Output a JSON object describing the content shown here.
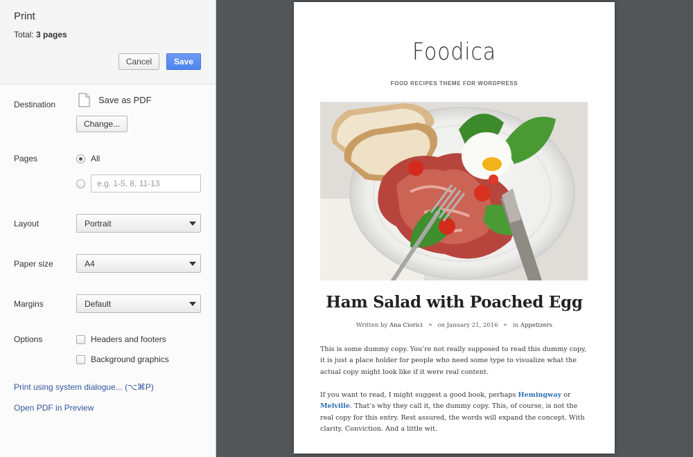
{
  "header": {
    "title": "Print",
    "total_label": "Total:",
    "total_value": "3 pages",
    "cancel_label": "Cancel",
    "save_label": "Save"
  },
  "destination": {
    "label": "Destination",
    "value": "Save as PDF",
    "change_label": "Change..."
  },
  "pages": {
    "label": "Pages",
    "all_label": "All",
    "all_selected": true,
    "custom_placeholder": "e.g. 1-5, 8, 11-13"
  },
  "layout": {
    "label": "Layout",
    "value": "Portrait"
  },
  "paper_size": {
    "label": "Paper size",
    "value": "A4"
  },
  "margins": {
    "label": "Margins",
    "value": "Default"
  },
  "options": {
    "label": "Options",
    "headers_footers": {
      "label": "Headers and footers",
      "checked": false
    },
    "background_graphics": {
      "label": "Background graphics",
      "checked": false
    }
  },
  "links": {
    "system_dialog": "Print using system dialogue... (⌥⌘P)",
    "open_pdf": "Open PDF in Preview"
  },
  "preview": {
    "site_title": "Foodica",
    "tagline": "FOOD RECIPES THEME FOR WORDPRESS",
    "post_title": "Ham Salad with Poached Egg",
    "meta": {
      "written_by": "Written by",
      "author": "Ana Ciorici",
      "on": "on January 21, 2016",
      "in": "in",
      "category": "Appetizers"
    },
    "para1": "This is some dummy copy. You’re not really supposed to read this dummy copy, it is just a place holder for people who need some type to visualize what the actual copy might look like if it were real content.",
    "para2_a": "If you want to read, I might suggest a good book, perhaps ",
    "para2_link1": "Hemingway",
    "para2_b": " or ",
    "para2_link2": "Melville",
    "para2_c": ". That’s why they call it, the dummy copy. This, of course, is not the real copy for this entry. Rest assured, the words will expand the concept. With clarity. Conviction. And a little wit."
  },
  "colors": {
    "save_button": "#4d84ee",
    "link": "#3056a0",
    "preview_background": "#525659",
    "article_link": "#2a6eb5"
  }
}
